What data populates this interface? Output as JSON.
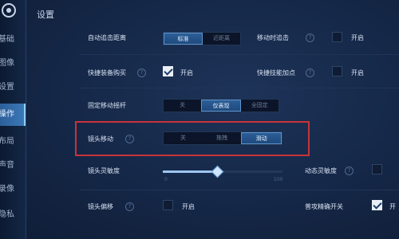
{
  "header": {
    "title": "设置"
  },
  "sidebar": {
    "items": [
      {
        "label": "基础",
        "active": false
      },
      {
        "label": "图像",
        "active": false
      },
      {
        "label": "设置",
        "active": false
      },
      {
        "label": "操作",
        "active": true
      },
      {
        "label": "布局",
        "active": false
      },
      {
        "label": "声音",
        "active": false
      },
      {
        "label": "录像",
        "active": false
      },
      {
        "label": "隐私",
        "active": false
      }
    ]
  },
  "settings": {
    "auto_chase_distance": {
      "label": "自动追击距离",
      "options": [
        "标准",
        "近距离"
      ],
      "selected": 0
    },
    "move_chase": {
      "label": "移动时追击",
      "checkbox_label": "开启",
      "checked": false
    },
    "quick_buy": {
      "label": "快捷装备购买",
      "checkbox_label": "开启",
      "checked": true
    },
    "quick_skill": {
      "label": "快捷技能加点",
      "checkbox_label": "开启",
      "checked": false
    },
    "fixed_joystick": {
      "label": "固定移动摇杆",
      "options": [
        "关",
        "仅表现",
        "全固定"
      ],
      "selected": 1
    },
    "camera_move": {
      "label": "镜头移动",
      "options": [
        "关",
        "拖拽",
        "滑动"
      ],
      "selected": 2
    },
    "camera_sensitivity": {
      "label": "镜头灵敏度",
      "value_fraction": 0.45,
      "min_label": "0",
      "max_label": "100"
    },
    "dynamic_sensitivity": {
      "label": "动态灵敏度",
      "checked": false
    },
    "camera_offset": {
      "label": "镜头偏移",
      "checkbox_label": "开启",
      "checked": false
    },
    "precise_attack": {
      "label": "普攻精确开关",
      "checked": true,
      "checkbox_label": "开"
    }
  },
  "colors": {
    "accent": "#2c5e97",
    "highlight": "#c9333a"
  }
}
